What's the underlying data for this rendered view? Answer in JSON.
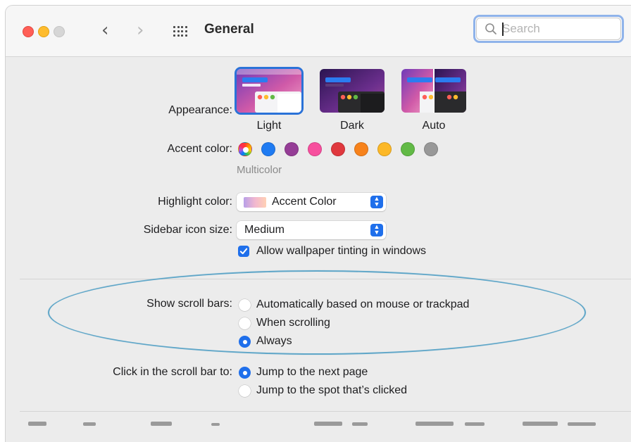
{
  "window": {
    "title": "General"
  },
  "toolbar": {
    "back": "‹",
    "forward": "›",
    "search": {
      "placeholder": "Search",
      "value": ""
    }
  },
  "appearance": {
    "label": "Appearance:",
    "options": [
      {
        "caption": "Light",
        "selected": true
      },
      {
        "caption": "Dark",
        "selected": false
      },
      {
        "caption": "Auto",
        "selected": false
      }
    ]
  },
  "accent": {
    "label": "Accent color:",
    "selected_name": "Multicolor",
    "swatches": [
      {
        "name": "multicolor",
        "color": "multicolor"
      },
      {
        "name": "blue",
        "color": "#1f7bf2"
      },
      {
        "name": "purple",
        "color": "#953d96"
      },
      {
        "name": "pink",
        "color": "#f74f9e"
      },
      {
        "name": "red",
        "color": "#e0383e"
      },
      {
        "name": "orange",
        "color": "#f7821b"
      },
      {
        "name": "yellow",
        "color": "#fcb827"
      },
      {
        "name": "green",
        "color": "#62ba46"
      },
      {
        "name": "graphite",
        "color": "#989898"
      }
    ]
  },
  "highlight": {
    "label": "Highlight color:",
    "value": "Accent Color"
  },
  "sidebar_icon": {
    "label": "Sidebar icon size:",
    "value": "Medium"
  },
  "wallpaper_tinting": {
    "label": "Allow wallpaper tinting in windows",
    "checked": true
  },
  "scroll_bars": {
    "label": "Show scroll bars:",
    "options": [
      {
        "label": "Automatically based on mouse or trackpad",
        "selected": false
      },
      {
        "label": "When scrolling",
        "selected": false
      },
      {
        "label": "Always",
        "selected": true
      }
    ]
  },
  "click_scroll": {
    "label": "Click in the scroll bar to:",
    "options": [
      {
        "label": "Jump to the next page",
        "selected": true
      },
      {
        "label": "Jump to the spot that’s clicked",
        "selected": false
      }
    ]
  },
  "colors": {
    "accent": "#1f6feb",
    "annotation": "#5fa6c8"
  }
}
